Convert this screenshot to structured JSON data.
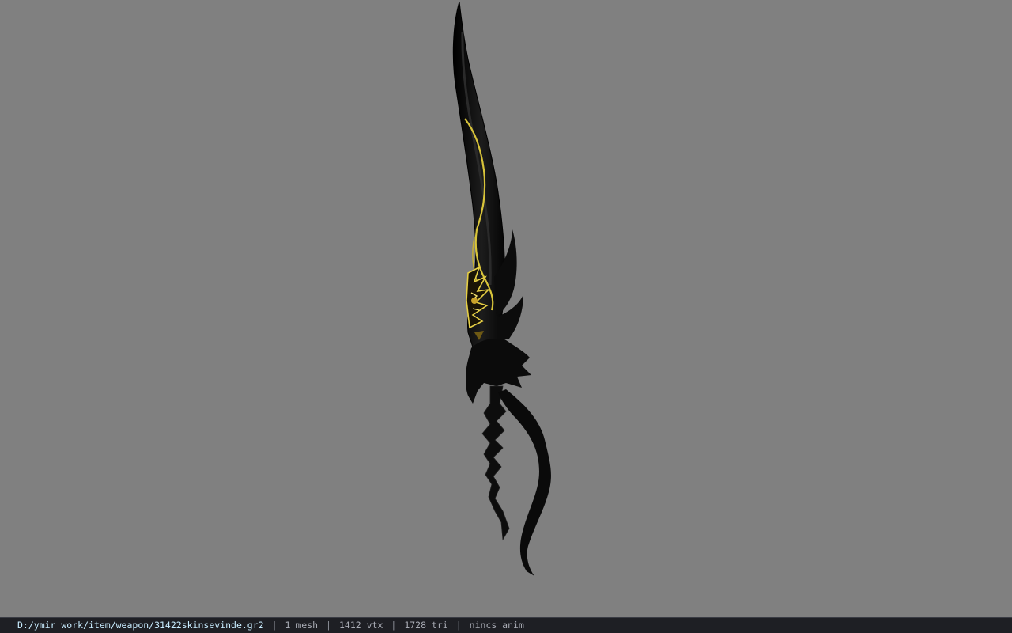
{
  "viewport": {
    "background_color": "#808080",
    "model": {
      "icon": "sword-model",
      "blade_color": "#0b0b0b",
      "trim_color": "#d8c43a"
    }
  },
  "status_bar": {
    "file_path": "D:/ymir work/item/weapon/31422skinsevinde.gr2",
    "separator": "|",
    "mesh_count": "1 mesh",
    "vertex_count": "1412 vtx",
    "triangle_count": "1728 tri",
    "anim_status": "nincs anim"
  }
}
